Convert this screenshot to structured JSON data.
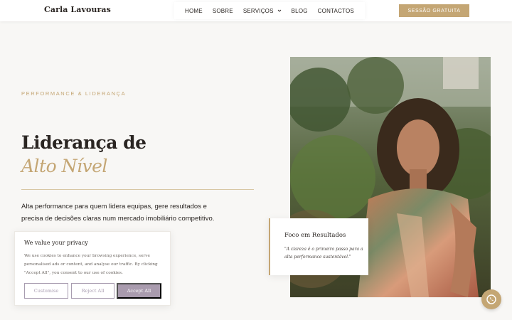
{
  "header": {
    "logo": "Carla Lavouras",
    "nav": [
      {
        "label": "HOME"
      },
      {
        "label": "SOBRE"
      },
      {
        "label": "SERVIÇOS",
        "icon": "chevron-down-icon"
      },
      {
        "label": "BLOG"
      },
      {
        "label": "CONTACTOS"
      }
    ],
    "cta_label": "SESSÃO GRATUITA"
  },
  "hero": {
    "eyebrow": "PERFORMANCE & LIDERANÇA",
    "title_line1": "Liderança de",
    "title_line2": "Alto Nível",
    "lead": "Alta performance para quem lidera equipas, gere resultados e precisa de decisões claras num mercado imobiliário competitivo."
  },
  "quote_card": {
    "title": "Foco em Resultados",
    "text": "\"A clareza é o primeiro passo para a alta performance sustentável.\""
  },
  "cookie": {
    "title": "We value your privacy",
    "text": "We use cookies to enhance your browsing experience, serve personalised ads or content, and analyse our traffic. By clicking \"Accept All\", you consent to our use of cookies.",
    "customise": "Customise",
    "reject": "Reject All",
    "accept": "Accept All"
  },
  "whatsapp": {
    "icon": "whatsapp-icon"
  },
  "colors": {
    "accent": "#c4a674",
    "text": "#2a2522",
    "cookie_accent": "#a99bae",
    "background": "#f8f7f5"
  }
}
